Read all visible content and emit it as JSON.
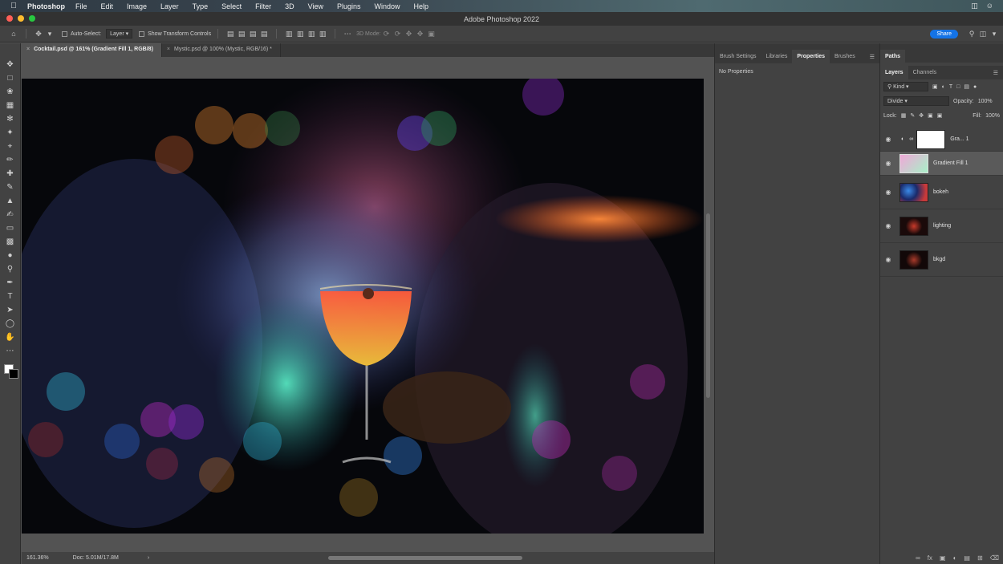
{
  "menubar": {
    "app": "Photoshop",
    "items": [
      "File",
      "Edit",
      "Image",
      "Layer",
      "Type",
      "Select",
      "Filter",
      "3D",
      "View",
      "Plugins",
      "Window",
      "Help"
    ]
  },
  "window": {
    "title": "Adobe Photoshop 2022"
  },
  "options": {
    "auto_select_label": "Auto-Select:",
    "auto_select_value": "Layer",
    "show_transform_label": "Show Transform Controls",
    "mode_3d": "3D Mode:",
    "share_label": "Share"
  },
  "tabs": [
    {
      "label": "Cocktail.psd @ 161% (Gradient Fill 1, RGB/8)",
      "close": "×"
    },
    {
      "label": "Mystic.psd @ 100% (Mystic, RGB/16) *",
      "close": "×"
    }
  ],
  "status": {
    "zoom": "161.36%",
    "doc": "Doc: 5.01M/17.8M"
  },
  "properties": {
    "tabs": [
      "Brush Settings",
      "Libraries",
      "Properties",
      "Brushes"
    ],
    "active": "Properties",
    "empty_text": "No Properties"
  },
  "rightpanel": {
    "top_tab": "Paths",
    "tabs": [
      "Layers",
      "Channels"
    ],
    "filter_kind": "Kind",
    "blend_mode": "Divide",
    "opacity_label": "Opacity:",
    "opacity_value": "100%",
    "lock_label": "Lock:",
    "fill_label": "Fill:",
    "fill_value": "100%"
  },
  "layers": [
    {
      "name": "Gra... 1"
    },
    {
      "name": "Gradient Fill 1"
    },
    {
      "name": "bokeh"
    },
    {
      "name": "lighting"
    },
    {
      "name": "bkgd"
    }
  ],
  "colors": {
    "accent": "#1473e6",
    "selected_layer": "#5a5a5a"
  }
}
